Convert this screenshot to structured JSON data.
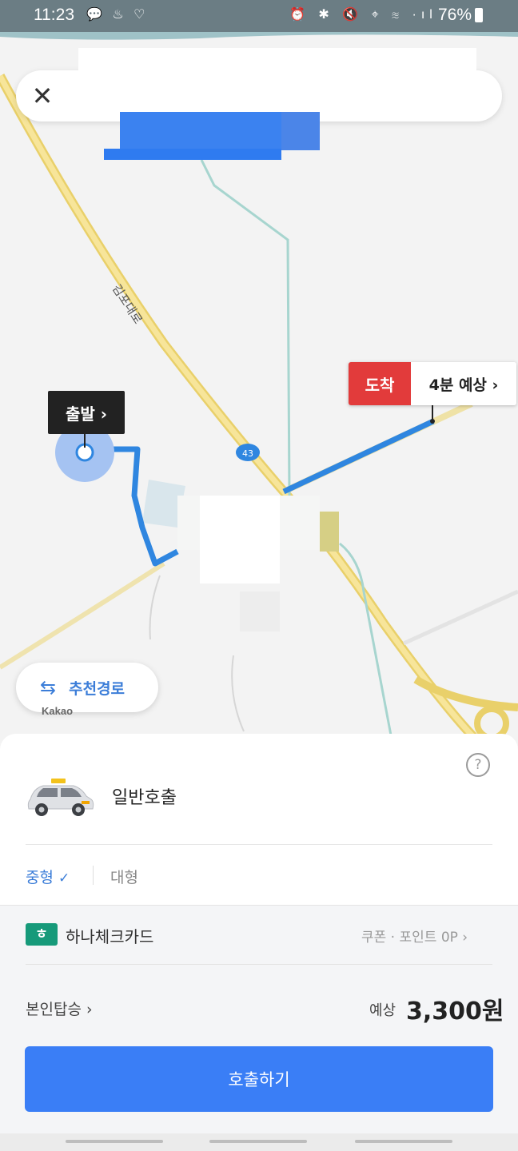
{
  "status_bar": {
    "time": "11:23",
    "notification_icons": "💬 ♨ ♡",
    "system_icons": "⏰ ✱ 🔇 ⌖ ≋ ·ıl",
    "battery_percent": "76%"
  },
  "map": {
    "road_name": "김포대로",
    "road_number": "43",
    "start_label": "출발 ›",
    "arrival_label": "도착",
    "eta_label": "4분 예상 ›",
    "recommend_route_button": "추천경로",
    "map_logo": "Kakao"
  },
  "sheet": {
    "help_icon": "?",
    "service_name": "일반호출",
    "size_options": [
      "중형",
      "대형"
    ],
    "selected_size": "중형",
    "checkmark": "✓",
    "payment_card": "하나체크카드",
    "coupon_point": "쿠폰 · 포인트 0P ›",
    "self_ride": "본인탑승 ›",
    "estimate_label": "예상",
    "price": "3,300원",
    "call_button": "호출하기"
  },
  "colors": {
    "accent": "#3a7ef6",
    "route": "#2f86e0",
    "arrival_red": "#e23b3b",
    "road_yellow": "#f2d56b"
  }
}
